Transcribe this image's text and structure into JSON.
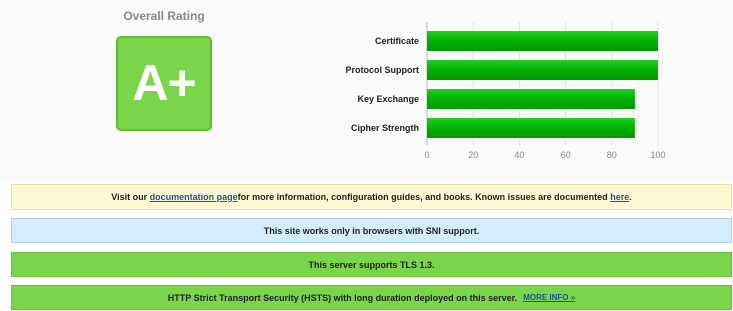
{
  "overall": {
    "title": "Overall Rating",
    "grade": "A+",
    "grade_color": "#7ad54b"
  },
  "chart_data": {
    "type": "bar",
    "orientation": "horizontal",
    "categories": [
      "Certificate",
      "Protocol Support",
      "Key Exchange",
      "Cipher Strength"
    ],
    "values": [
      100,
      100,
      90,
      90
    ],
    "xlim": [
      0,
      100
    ],
    "xticks": [
      0,
      20,
      40,
      60,
      80,
      100
    ],
    "grid": true,
    "bar_color": "#00b000"
  },
  "notices": {
    "docs": {
      "prefix": "Visit our ",
      "link1": "documentation page",
      "middle": " for more information, configuration guides, and books. Known issues are documented ",
      "link2": "here",
      "suffix": "."
    },
    "sni": "This site works only in browsers with SNI support.",
    "tls13": "This server supports TLS 1.3.",
    "hsts": "HTTP Strict Transport Security (HSTS) with long duration deployed on this server.",
    "more_info": "MORE INFO »"
  }
}
